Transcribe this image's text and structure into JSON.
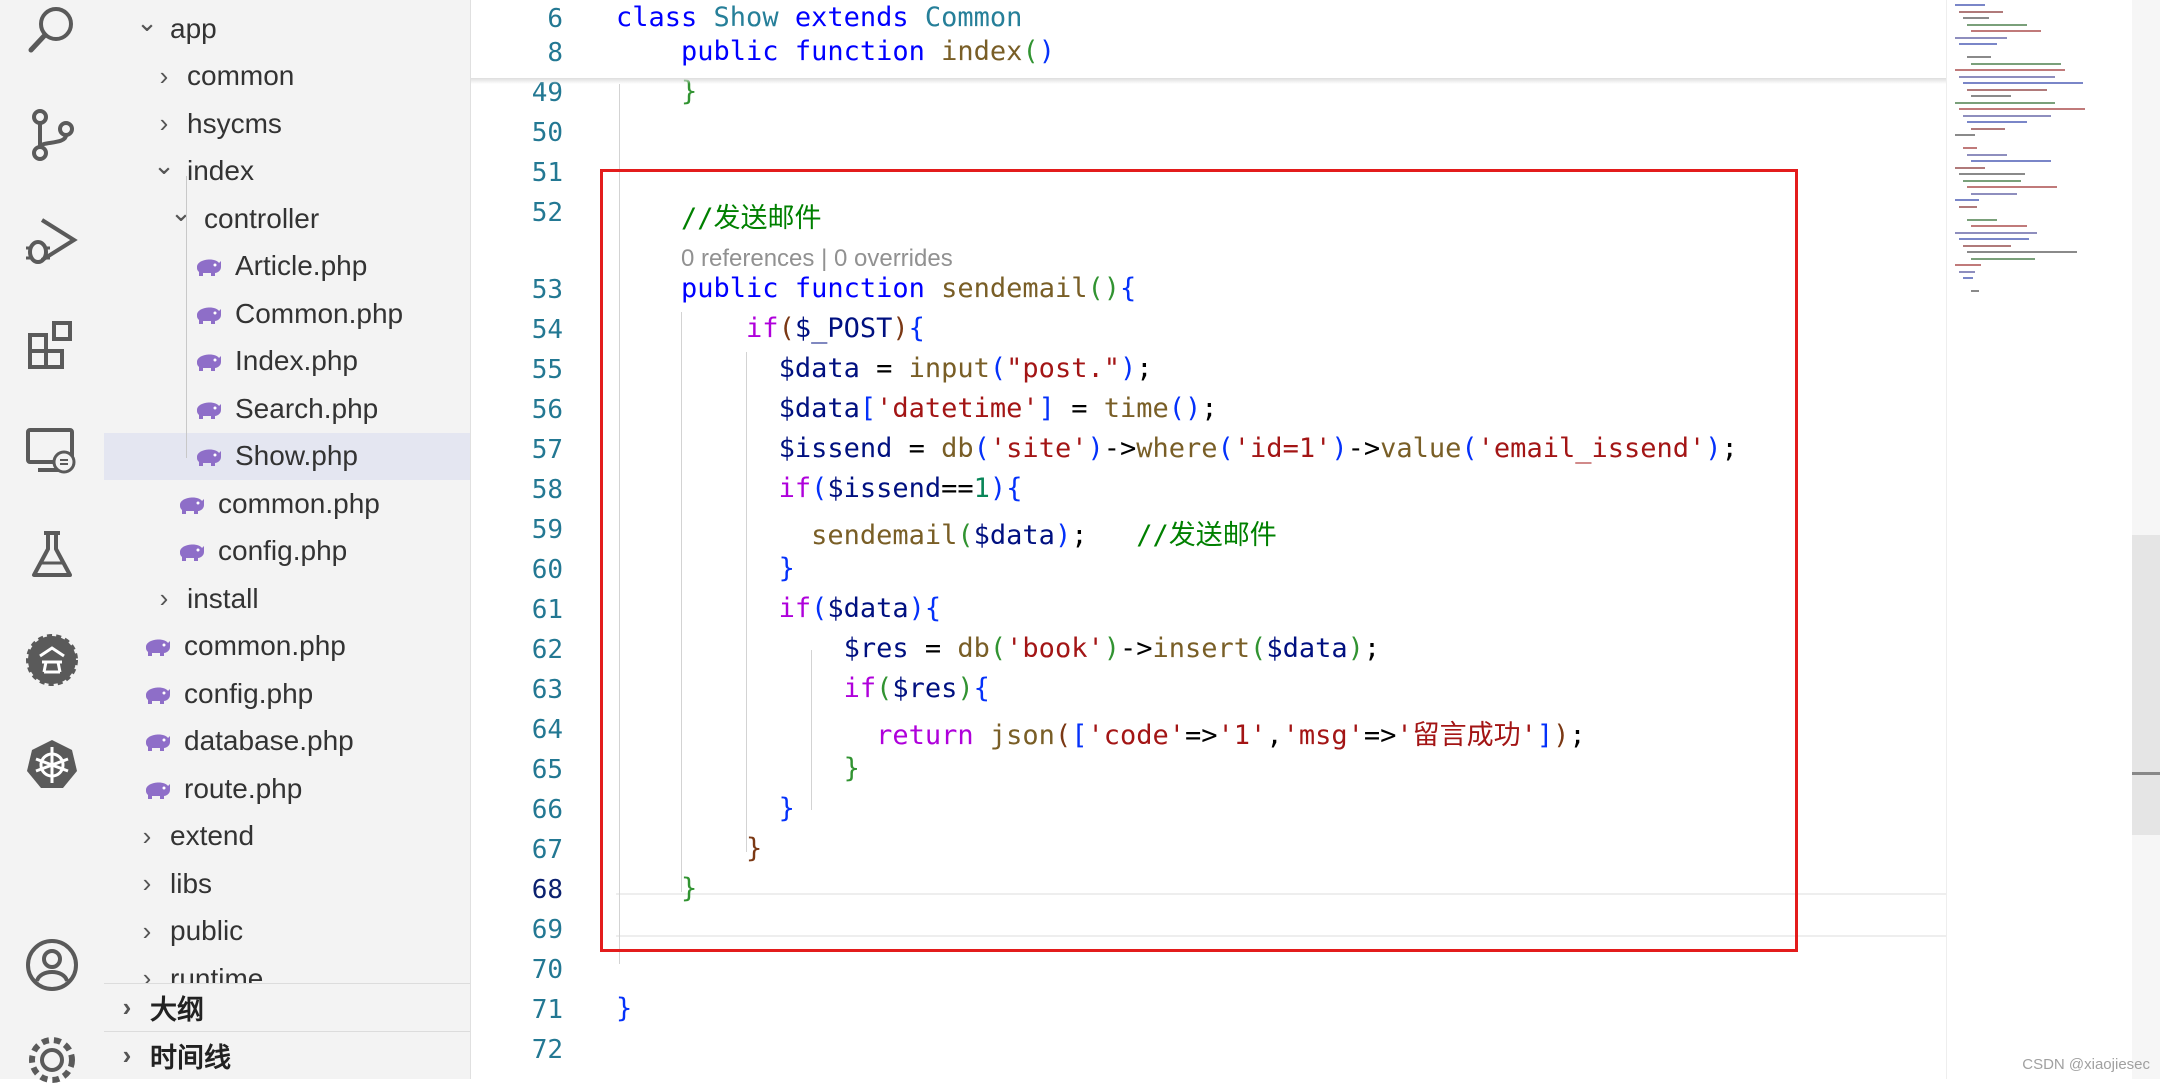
{
  "activity_bar": {
    "icons": [
      "search-icon",
      "source-control-icon",
      "run-debug-icon",
      "extensions-icon",
      "remote-explorer-icon",
      "testing-icon",
      "codegeex-icon",
      "kubernetes-icon",
      "account-icon",
      "settings-gear-icon"
    ]
  },
  "explorer": {
    "tree": [
      {
        "label": "app",
        "kind": "folder-open"
      },
      {
        "label": "common",
        "kind": "folder"
      },
      {
        "label": "hsycms",
        "kind": "folder"
      },
      {
        "label": "index",
        "kind": "folder-open"
      },
      {
        "label": "controller",
        "kind": "folder-open"
      },
      {
        "label": "Article.php",
        "kind": "php"
      },
      {
        "label": "Common.php",
        "kind": "php"
      },
      {
        "label": "Index.php",
        "kind": "php"
      },
      {
        "label": "Search.php",
        "kind": "php"
      },
      {
        "label": "Show.php",
        "kind": "php",
        "selected": true
      },
      {
        "label": "common.php",
        "kind": "php"
      },
      {
        "label": "config.php",
        "kind": "php"
      },
      {
        "label": "install",
        "kind": "folder"
      },
      {
        "label": "common.php",
        "kind": "php"
      },
      {
        "label": "config.php",
        "kind": "php"
      },
      {
        "label": "database.php",
        "kind": "php"
      },
      {
        "label": "route.php",
        "kind": "php"
      },
      {
        "label": "extend",
        "kind": "folder"
      },
      {
        "label": "libs",
        "kind": "folder"
      },
      {
        "label": "public",
        "kind": "folder"
      },
      {
        "label": "runtime",
        "kind": "folder"
      }
    ],
    "outline_label": "大纲",
    "timeline_label": "时间线"
  },
  "editor": {
    "codelens": "0 references | 0 overrides",
    "active_line": "68",
    "lines": [
      {
        "n": "6",
        "text": "class Show extends Common"
      },
      {
        "n": "8",
        "text": "    public function index()"
      },
      {
        "n": "49",
        "text": "    }"
      },
      {
        "n": "50",
        "text": ""
      },
      {
        "n": "51",
        "text": ""
      },
      {
        "n": "52",
        "text": "    //发送邮件"
      },
      {
        "n": "53",
        "text": "    public function sendemail(){"
      },
      {
        "n": "54",
        "text": "        if($_POST){"
      },
      {
        "n": "55",
        "text": "          $data = input(\"post.\");"
      },
      {
        "n": "56",
        "text": "          $data['datetime'] = time();"
      },
      {
        "n": "57",
        "text": "          $issend = db('site')->where('id=1')->value('email_issend');"
      },
      {
        "n": "58",
        "text": "          if($issend==1){"
      },
      {
        "n": "59",
        "text": "            sendemail($data);   //发送邮件"
      },
      {
        "n": "60",
        "text": "          }"
      },
      {
        "n": "61",
        "text": "          if($data){"
      },
      {
        "n": "62",
        "text": "              $res = db('book')->insert($data);"
      },
      {
        "n": "63",
        "text": "              if($res){"
      },
      {
        "n": "64",
        "text": "                return json(['code'=>'1','msg'=>'留言成功']);"
      },
      {
        "n": "65",
        "text": "              }"
      },
      {
        "n": "66",
        "text": "          }"
      },
      {
        "n": "67",
        "text": "        }"
      },
      {
        "n": "68",
        "text": "    }"
      },
      {
        "n": "69",
        "text": ""
      },
      {
        "n": "70",
        "text": ""
      },
      {
        "n": "71",
        "text": "}"
      },
      {
        "n": "72",
        "text": ""
      }
    ]
  },
  "colors": {
    "highlight_box": "#e31c1c",
    "keyword": "#0000ff",
    "control": "#af00db",
    "function": "#795e26",
    "variable": "#001080",
    "string": "#a31515",
    "number": "#098658",
    "comment": "#008000",
    "class": "#267f99"
  },
  "watermark": "CSDN @xiaojiesec"
}
